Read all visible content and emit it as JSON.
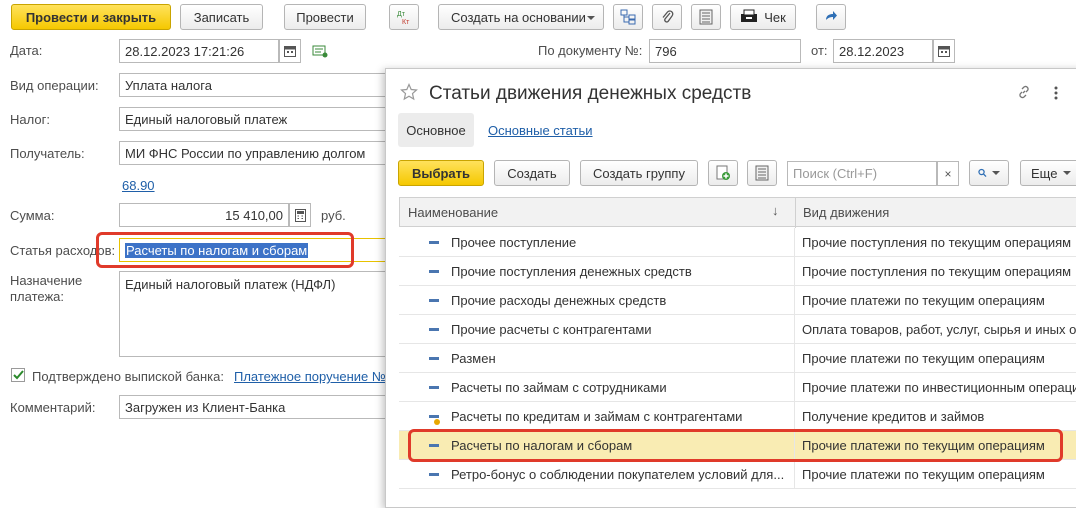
{
  "toolbar": {
    "post_close": "Провести и закрыть",
    "save": "Записать",
    "post": "Провести",
    "create_basis": "Создать на основании",
    "check": "Чек"
  },
  "form": {
    "date_label": "Дата:",
    "date_value": "28.12.2023 17:21:26",
    "doc_number_label": "По документу №:",
    "doc_number_value": "796",
    "from_label": "от:",
    "from_value": "28.12.2023",
    "op_type_label": "Вид операции:",
    "op_type_value": "Уплата налога",
    "tax_label": "Налог:",
    "tax_value": "Единый налоговый платеж",
    "recipient_label": "Получатель:",
    "recipient_value": "МИ ФНС России по управлению долгом",
    "account_link": "68.90",
    "sum_label": "Сумма:",
    "sum_value": "15 410,00",
    "currency": "руб.",
    "expense_label": "Статья расходов:",
    "expense_value": "Расчеты по налогам и сборам",
    "purpose_label_1": "Назначение",
    "purpose_label_2": "платежа:",
    "purpose_value": "Единый налоговый платеж (НДФЛ)",
    "confirmed_label": "Подтверждено выпиской банка:",
    "payment_order_link": "Платежное поручение №",
    "comment_label": "Комментарий:",
    "comment_value": "Загружен из Клиент-Банка"
  },
  "popup": {
    "title": "Статьи движения денежных средств",
    "tab_main": "Основное",
    "tab_articles": "Основные статьи",
    "select_btn": "Выбрать",
    "create_btn": "Создать",
    "create_group_btn": "Создать группу",
    "search_placeholder": "Поиск (Ctrl+F)",
    "more_btn": "Еще",
    "col_name": "Наименование",
    "col_movement": "Вид движения",
    "rows": [
      {
        "name": "Прочее поступление",
        "movement": "Прочие поступления по текущим операциям"
      },
      {
        "name": "Прочие поступления денежных средств",
        "movement": "Прочие поступления по текущим операциям"
      },
      {
        "name": "Прочие расходы денежных средств",
        "movement": "Прочие платежи по текущим операциям"
      },
      {
        "name": "Прочие расчеты с контрагентами",
        "movement": "Оплата товаров, работ, услуг, сырья и иных о"
      },
      {
        "name": "Размен",
        "movement": "Прочие платежи по текущим операциям"
      },
      {
        "name": "Расчеты по займам с сотрудниками",
        "movement": "Прочие платежи по инвестиционным операци"
      },
      {
        "name": "Расчеты по кредитам и займам с контрагентами",
        "movement": "Получение кредитов и займов"
      },
      {
        "name": "Расчеты по налогам и сборам",
        "movement": "Прочие платежи по текущим операциям"
      },
      {
        "name": "Ретро-бонус о соблюдении покупателем условий для...",
        "movement": "Прочие платежи по текущим операциям"
      }
    ]
  }
}
